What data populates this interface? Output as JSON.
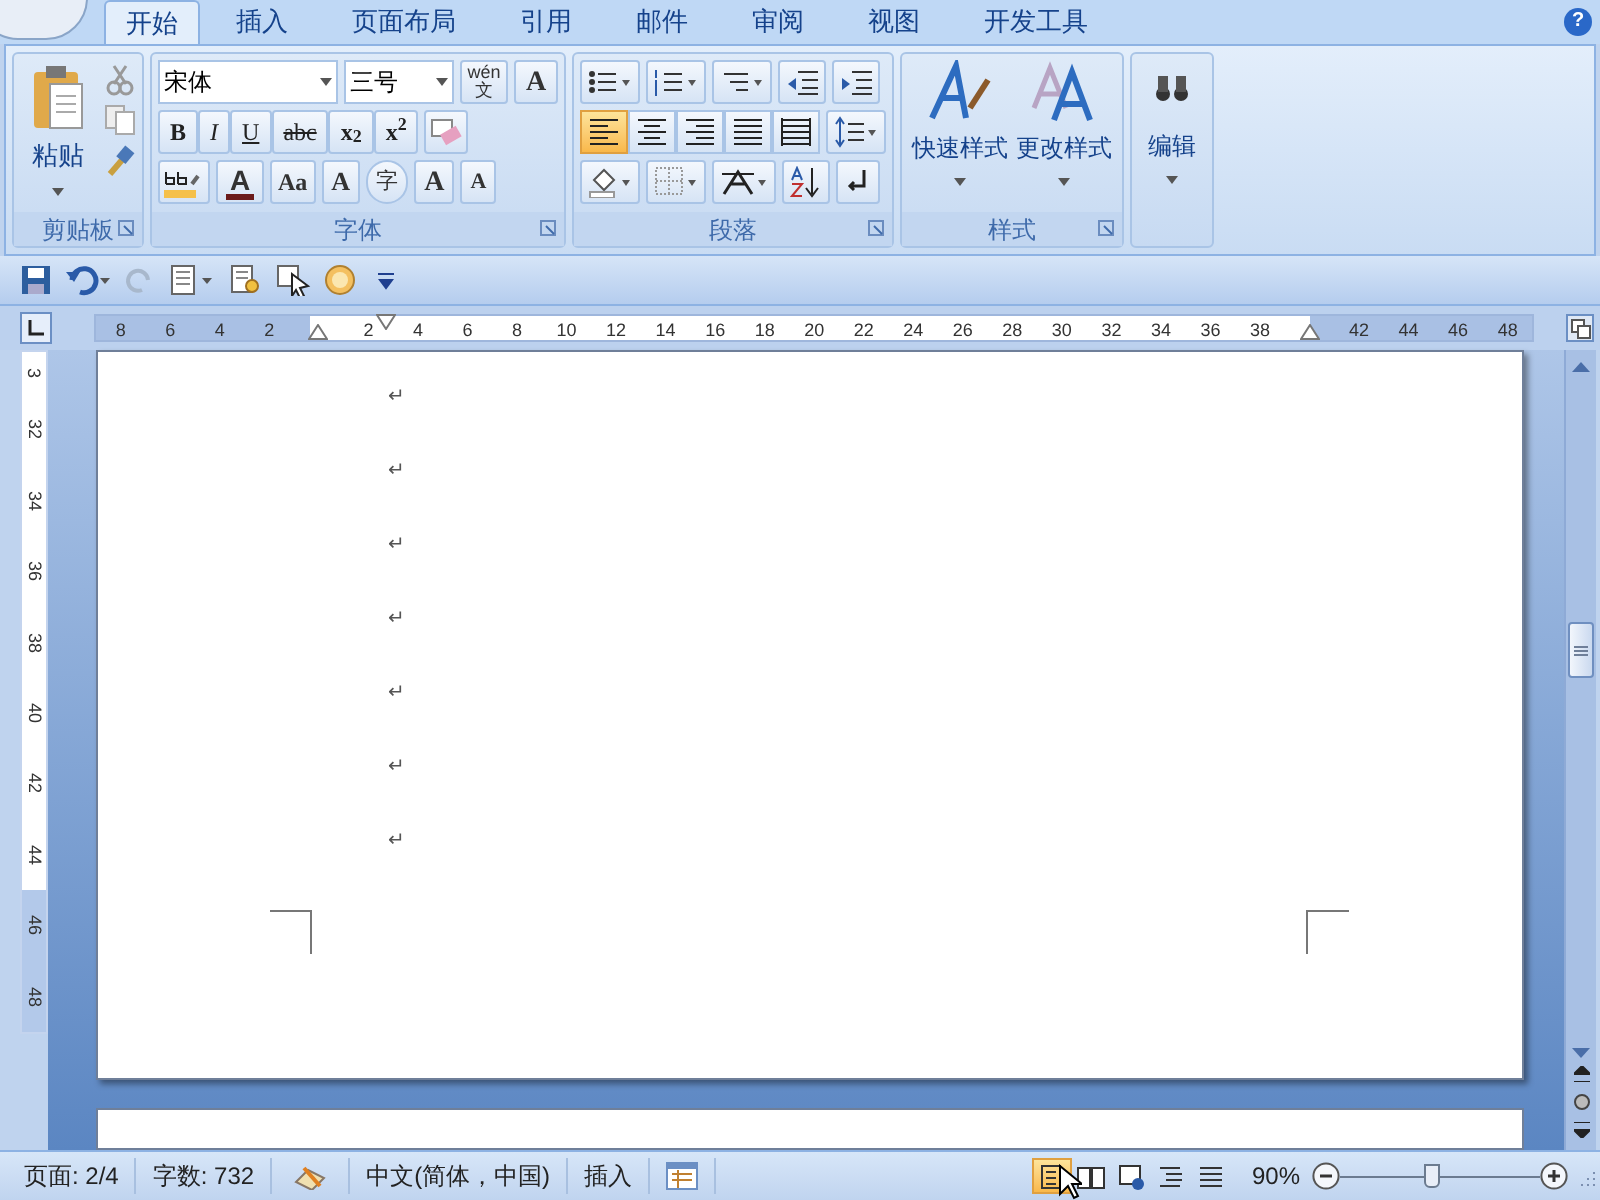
{
  "help": "?",
  "tabs": [
    {
      "label": "开始",
      "selected": true
    },
    {
      "label": "插入",
      "selected": false
    },
    {
      "label": "页面布局",
      "selected": false
    },
    {
      "label": "引用",
      "selected": false
    },
    {
      "label": "邮件",
      "selected": false
    },
    {
      "label": "审阅",
      "selected": false
    },
    {
      "label": "视图",
      "selected": false
    },
    {
      "label": "开发工具",
      "selected": false
    }
  ],
  "clipboard": {
    "title": "剪贴板",
    "paste": "粘贴"
  },
  "font": {
    "title": "字体",
    "font_name": "宋体",
    "font_size": "三号",
    "phonetic": "wén 文",
    "border_char": "A",
    "format_buttons": [
      "B",
      "I",
      "U",
      "abc",
      "x$_{2}$",
      "x$^{2}$"
    ],
    "color_buttons": [
      "A",
      "Aa"
    ],
    "effect_buttons": [
      "A",
      "字",
      "A",
      "A"
    ]
  },
  "paragraph": {
    "title": "段落",
    "alignments": [
      {
        "selected": true
      },
      {
        "selected": false
      },
      {
        "selected": false
      },
      {
        "selected": false
      },
      {
        "selected": false
      }
    ]
  },
  "styles": {
    "title": "样式",
    "buttons": [
      "快速样式",
      "更改样式"
    ]
  },
  "editing": {
    "label": "编辑"
  },
  "ruler": {
    "horizontal": [
      {
        "kind": "number",
        "text": "8"
      },
      {
        "kind": "number",
        "text": "6"
      },
      {
        "kind": "number",
        "text": "4"
      },
      {
        "kind": "number",
        "text": "2"
      },
      {
        "kind": "indent"
      },
      {
        "kind": "number",
        "text": "2"
      },
      {
        "kind": "number",
        "text": "4"
      },
      {
        "kind": "number",
        "text": "6"
      },
      {
        "kind": "number",
        "text": "8"
      },
      {
        "kind": "number",
        "text": "10"
      },
      {
        "kind": "number",
        "text": "12"
      },
      {
        "kind": "number",
        "text": "14"
      },
      {
        "kind": "number",
        "text": "16"
      },
      {
        "kind": "number",
        "text": "18"
      },
      {
        "kind": "number",
        "text": "20"
      },
      {
        "kind": "number",
        "text": "22"
      },
      {
        "kind": "number",
        "text": "24"
      },
      {
        "kind": "number",
        "text": "26"
      },
      {
        "kind": "number",
        "text": "28"
      },
      {
        "kind": "number",
        "text": "30"
      },
      {
        "kind": "number",
        "text": "32"
      },
      {
        "kind": "number",
        "text": "34"
      },
      {
        "kind": "number",
        "text": "36"
      },
      {
        "kind": "number",
        "text": "38"
      },
      {
        "kind": "indent"
      },
      {
        "kind": "number",
        "text": "42"
      },
      {
        "kind": "number",
        "text": "44"
      },
      {
        "kind": "number",
        "text": "46"
      },
      {
        "kind": "number",
        "text": "48"
      }
    ],
    "vertical": [
      "3",
      "32",
      "34",
      "36",
      "38",
      "40",
      "42",
      "44",
      "46",
      "48"
    ]
  },
  "document": {
    "paragraph_marks": [
      "↵",
      "↵",
      "↵",
      "↵",
      "↵",
      "↵",
      "↵"
    ]
  },
  "status_bar": {
    "page": "页面: 2/4",
    "words": "字数: 732",
    "language": "中文(简体，中国)",
    "mode": "插入",
    "views": [
      {
        "selected": true
      },
      {
        "selected": false
      },
      {
        "selected": false
      },
      {
        "selected": false
      },
      {
        "selected": false
      }
    ],
    "zoom": "90%",
    "zoom_slider": {
      "level": 0.46
    }
  }
}
